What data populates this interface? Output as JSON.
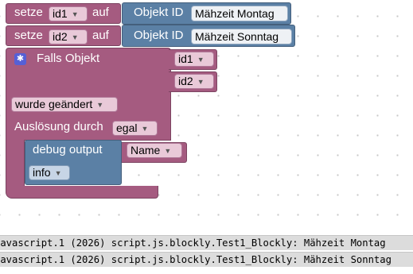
{
  "blocks": {
    "set1": {
      "keyword": "setze",
      "var": "id1",
      "on_label": "auf",
      "objekt_label": "Objekt ID",
      "objekt_value": "Mähzeit Montag"
    },
    "set2": {
      "keyword": "setze",
      "var": "id2",
      "on_label": "auf",
      "objekt_label": "Objekt ID",
      "objekt_value": "Mähzeit Sonntag"
    },
    "trigger": {
      "title": "Falls Objekt",
      "id_inputs": [
        "id1",
        "id2"
      ],
      "changed_label": "wurde geändert",
      "trigger_label": "Auslösung durch",
      "trigger_value": "egal"
    },
    "debug": {
      "title": "debug output",
      "value": "Name",
      "level": "info"
    }
  },
  "console": {
    "lines": [
      "javascript.1 (2026) script.js.blockly.Test1_Blockly: Mähzeit Montag",
      "javascript.1 (2026) script.js.blockly.Test1_Blockly: Mähzeit Sonntag"
    ]
  },
  "colors": {
    "variable_block": "#a55b80",
    "object_block": "#5b80a5",
    "gear": "#5560d6",
    "console_bg": "#dcdcdc"
  },
  "icons": {
    "trigger_settings": "gear-icon",
    "dropdown": "chevron-down-icon"
  }
}
